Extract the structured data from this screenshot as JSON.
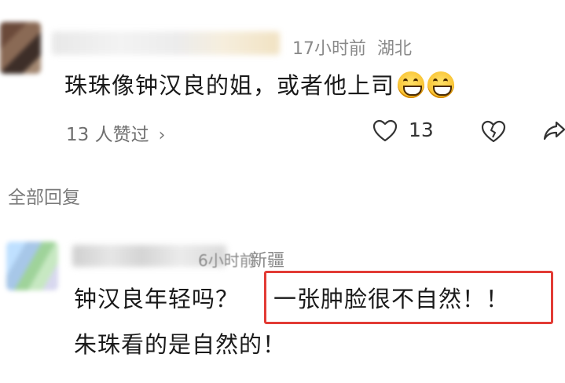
{
  "comment1": {
    "time": "17小时前",
    "location": "湖北",
    "text": "珠珠像钟汉良的姐，或者他上司",
    "emojis": [
      "grin-emoji",
      "grin-emoji"
    ],
    "likers": "13 人赞过",
    "like_count": "13"
  },
  "all_replies": "全部回复",
  "comment2": {
    "time": "6小时前",
    "location": "新疆",
    "line1_start": "钟汉良年轻吗？",
    "highlighted": "一张肿脸很不自然！！",
    "line2": "朱珠看的是自然的！"
  },
  "colors": {
    "highlight_border": "#e23b35",
    "secondary_text": "#8a8a8a"
  }
}
